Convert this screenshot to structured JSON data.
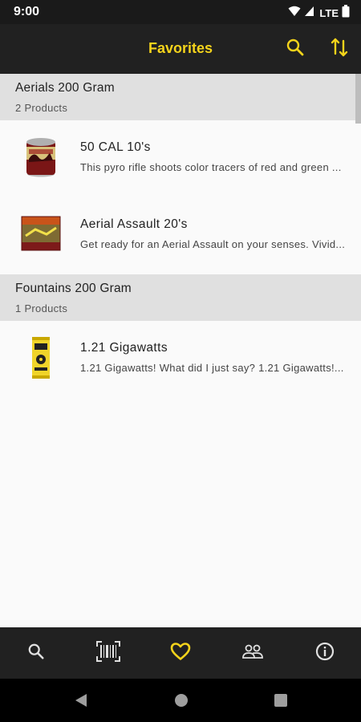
{
  "status_bar": {
    "time": "9:00",
    "network": "LTE"
  },
  "app_bar": {
    "title": "Favorites",
    "icons": [
      "search-icon",
      "sort-icon"
    ]
  },
  "sections": [
    {
      "title": "Aerials 200 Gram",
      "count": "2 Products",
      "items": [
        {
          "title": "50 CAL 10's",
          "description": "This pyro rifle shoots color tracers of red and green ..."
        },
        {
          "title": "Aerial Assault 20's",
          "description": "Get ready for an Aerial Assault on your senses. Vivid..."
        }
      ]
    },
    {
      "title": "Fountains 200 Gram",
      "count": "1 Products",
      "items": [
        {
          "title": "1.21 Gigawatts",
          "description": "1.21 Gigawatts! What did I just say? 1.21 Gigawatts!..."
        }
      ]
    }
  ],
  "bottom_nav": {
    "items": [
      "search-icon",
      "barcode-scan-icon",
      "heart-icon",
      "group-icon",
      "info-icon"
    ],
    "active": "heart-icon"
  },
  "colors": {
    "accent": "#f4d31b",
    "app_bar": "#212121",
    "section_header": "#e0e0e0",
    "nav_icon": "#e0e0e0"
  }
}
